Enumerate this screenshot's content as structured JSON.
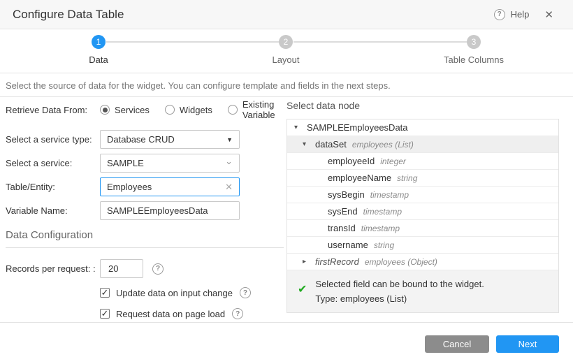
{
  "header": {
    "title": "Configure Data Table",
    "help_label": "Help",
    "help_icon": "?",
    "close_icon": "✕"
  },
  "stepper": {
    "steps": [
      {
        "num": "1",
        "label": "Data",
        "active": true
      },
      {
        "num": "2",
        "label": "Layout",
        "active": false
      },
      {
        "num": "3",
        "label": "Table Columns",
        "active": false
      }
    ]
  },
  "description": "Select the source of data for the widget. You can configure template and fields in the next steps.",
  "form": {
    "retrieve_label": "Retrieve Data From:",
    "radios": [
      {
        "label": "Services",
        "selected": true
      },
      {
        "label": "Widgets",
        "selected": false
      },
      {
        "label": "Existing Variable",
        "selected": false
      }
    ],
    "service_type_label": "Select a service type:",
    "service_type_value": "Database CRUD",
    "service_label": "Select a service:",
    "service_value": "SAMPLE",
    "table_label": "Table/Entity:",
    "table_value": "Employees",
    "clear_icon": "✕",
    "variable_label": "Variable Name:",
    "variable_value": "SAMPLEEmployeesData",
    "section_title": "Data Configuration",
    "records_label": "Records per request: :",
    "records_value": "20",
    "checkboxes": [
      {
        "label": "Update data on input change",
        "checked": true
      },
      {
        "label": "Request data on page load",
        "checked": true
      }
    ]
  },
  "data_node": {
    "title": "Select data node",
    "tree": [
      {
        "level": 0,
        "caret": "down",
        "name": "SAMPLEEmployeesData",
        "type": "",
        "italic": false,
        "selected": false
      },
      {
        "level": 1,
        "caret": "down",
        "name": "dataSet",
        "type": "employees (List)",
        "italic": false,
        "selected": true
      },
      {
        "level": 2,
        "caret": "",
        "name": "employeeId",
        "type": "integer",
        "italic": false,
        "selected": false
      },
      {
        "level": 2,
        "caret": "",
        "name": "employeeName",
        "type": "string",
        "italic": false,
        "selected": false
      },
      {
        "level": 2,
        "caret": "",
        "name": "sysBegin",
        "type": "timestamp",
        "italic": false,
        "selected": false
      },
      {
        "level": 2,
        "caret": "",
        "name": "sysEnd",
        "type": "timestamp",
        "italic": false,
        "selected": false
      },
      {
        "level": 2,
        "caret": "",
        "name": "transId",
        "type": "timestamp",
        "italic": false,
        "selected": false
      },
      {
        "level": 2,
        "caret": "",
        "name": "username",
        "type": "string",
        "italic": false,
        "selected": false
      },
      {
        "level": 1,
        "caret": "right",
        "name": "firstRecord",
        "type": "employees (Object)",
        "italic": true,
        "selected": false
      }
    ],
    "message": {
      "check_icon": "✔",
      "line1": "Selected field can be bound to the widget.",
      "line2": "Type: employees (List)"
    }
  },
  "footer": {
    "cancel_label": "Cancel",
    "next_label": "Next"
  },
  "colors": {
    "accent": "#2196f3",
    "success_green": "#1faa1f",
    "cancel_gray": "#8c8c8c"
  }
}
